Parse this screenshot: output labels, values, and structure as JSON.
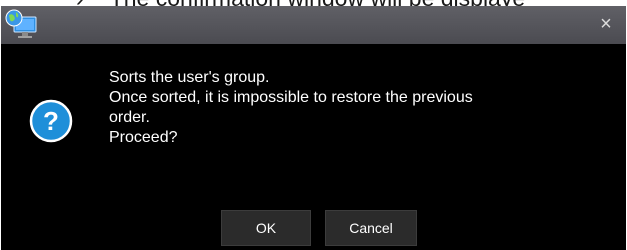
{
  "caption": {
    "text": "The confirmation window will be displaye"
  },
  "dialog": {
    "close_glyph": "×",
    "icons": {
      "app": "globe-monitor-icon",
      "question": "question-icon",
      "question_color": "#1e8fd9"
    },
    "message_lines": [
      "Sorts the user's group.",
      "Once sorted, it is impossible to restore the previous",
      "order.",
      "Proceed?"
    ],
    "buttons": {
      "ok_label": "OK",
      "cancel_label": "Cancel"
    }
  }
}
